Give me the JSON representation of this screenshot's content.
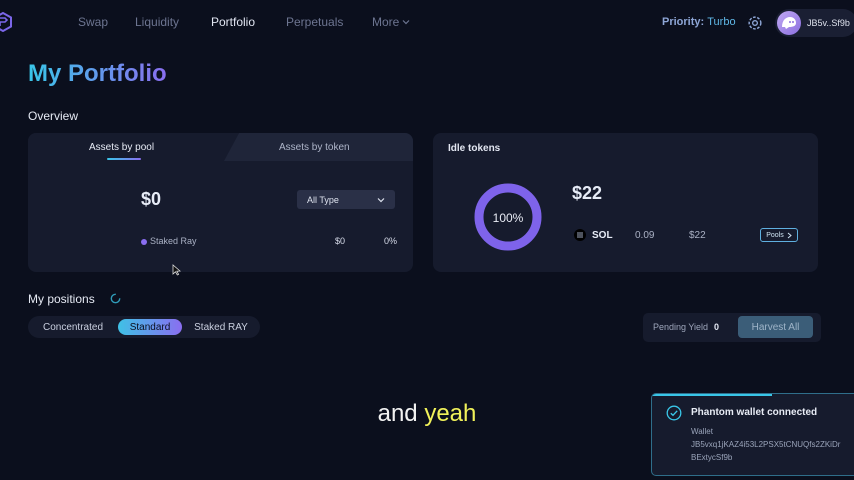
{
  "nav": {
    "items": [
      "Swap",
      "Liquidity",
      "Portfolio",
      "Perpetuals",
      "More"
    ],
    "active": "Portfolio",
    "priority_label": "Priority:",
    "priority_value": "Turbo",
    "wallet_short": "JB5v..Sf9b"
  },
  "page": {
    "title": "My Portfolio"
  },
  "overview": {
    "heading": "Overview",
    "tabs": [
      "Assets by pool",
      "Assets by token"
    ],
    "total": "$0",
    "filter_selected": "All Type",
    "rows": [
      {
        "label": "Staked Ray",
        "value": "$0",
        "percent": "0%"
      }
    ]
  },
  "idle": {
    "heading": "Idle tokens",
    "total": "$22",
    "donut_label": "100%",
    "donut_fraction": 1.0,
    "token": {
      "symbol": "SOL",
      "amount": "0.09",
      "value": "$22",
      "button": "Pools"
    }
  },
  "positions": {
    "heading": "My positions",
    "tabs": [
      "Concentrated",
      "Standard",
      "Staked RAY"
    ],
    "active_tab": "Standard",
    "pending_label": "Pending Yield",
    "pending_value": "0",
    "harvest_label": "Harvest All"
  },
  "caption": {
    "plain": "and",
    "highlight": "yeah"
  },
  "toast": {
    "title": "Phantom wallet connected",
    "label": "Wallet",
    "line1": "JB5vxq1jKAZ4i53L2PSX5tCNUQfs2ZKiDr",
    "line2": "BExtycSf9b"
  },
  "colors": {
    "accent_cyan": "#39c6e8",
    "accent_purple": "#8a6ef0",
    "caption_highlight": "#f1f25a"
  }
}
